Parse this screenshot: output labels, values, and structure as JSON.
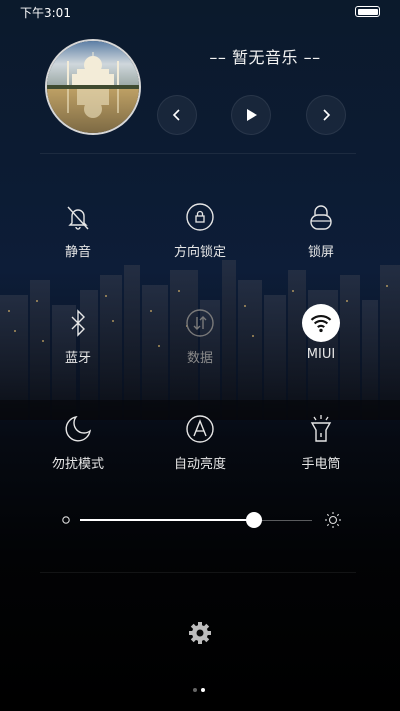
{
  "status_bar": {
    "time": "下午3:01",
    "battery_icon": "battery-full-icon"
  },
  "music": {
    "title": "–– 暂无音乐 ––",
    "album_art": "album-art-taj-mahal",
    "controls": [
      "previous-icon",
      "play-icon",
      "next-icon"
    ]
  },
  "toggles": [
    {
      "label": "静音",
      "icon": "bell-muted-icon",
      "state": "off"
    },
    {
      "label": "方向锁定",
      "icon": "rotation-lock-icon",
      "state": "off"
    },
    {
      "label": "锁屏",
      "icon": "lock-icon",
      "state": "off"
    },
    {
      "label": "蓝牙",
      "icon": "bluetooth-icon",
      "state": "off"
    },
    {
      "label": "数据",
      "icon": "mobile-data-icon",
      "state": "disabled"
    },
    {
      "label": "MIUI",
      "icon": "wifi-icon",
      "state": "on"
    },
    {
      "label": "勿扰模式",
      "icon": "moon-icon",
      "state": "off"
    },
    {
      "label": "自动亮度",
      "icon": "auto-brightness-icon",
      "state": "off"
    },
    {
      "label": "手电筒",
      "icon": "flashlight-icon",
      "state": "off"
    }
  ],
  "brightness": {
    "value": 0.75,
    "min_icon": "dim-sun-icon",
    "max_icon": "bright-sun-icon"
  },
  "settings_icon": "gear-icon",
  "pager": {
    "pages": 2,
    "current": 2
  },
  "colors": {
    "active_toggle_bg": "#ffffff",
    "label": "#e6e6e6",
    "disabled_label": "#8a8a8a"
  }
}
